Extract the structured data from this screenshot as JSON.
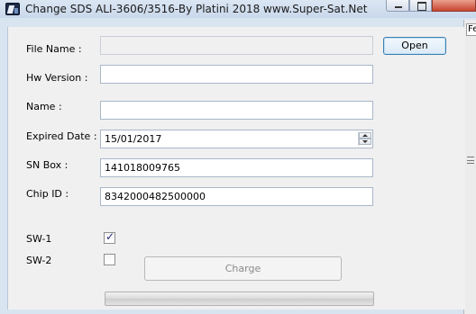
{
  "window": {
    "title": "Change SDS ALI-3606/3516-By Platini 2018 www.Super-Sat.Net",
    "icon": "app-icon"
  },
  "form": {
    "file_name": {
      "label": "File Name  :",
      "value": ""
    },
    "hw_version": {
      "label": "Hw Version  :",
      "value": ""
    },
    "name": {
      "label": "Name  :",
      "value": ""
    },
    "expired_date": {
      "label": "Expired Date  :",
      "value": "15/01/2017"
    },
    "sn_box": {
      "label": "SN Box  :",
      "value": "141018009765"
    },
    "chip_id": {
      "label": "Chip ID  :",
      "value": "8342000482500000"
    }
  },
  "buttons": {
    "open": "Open",
    "charge": "Charge"
  },
  "options": {
    "sw1": {
      "label": "SW-1",
      "checked": true,
      "mark": "✓"
    },
    "sw2": {
      "label": "SW-2",
      "checked": false
    }
  },
  "progress": {
    "value": 0
  },
  "background_window": {
    "tab_text": "Fe"
  }
}
